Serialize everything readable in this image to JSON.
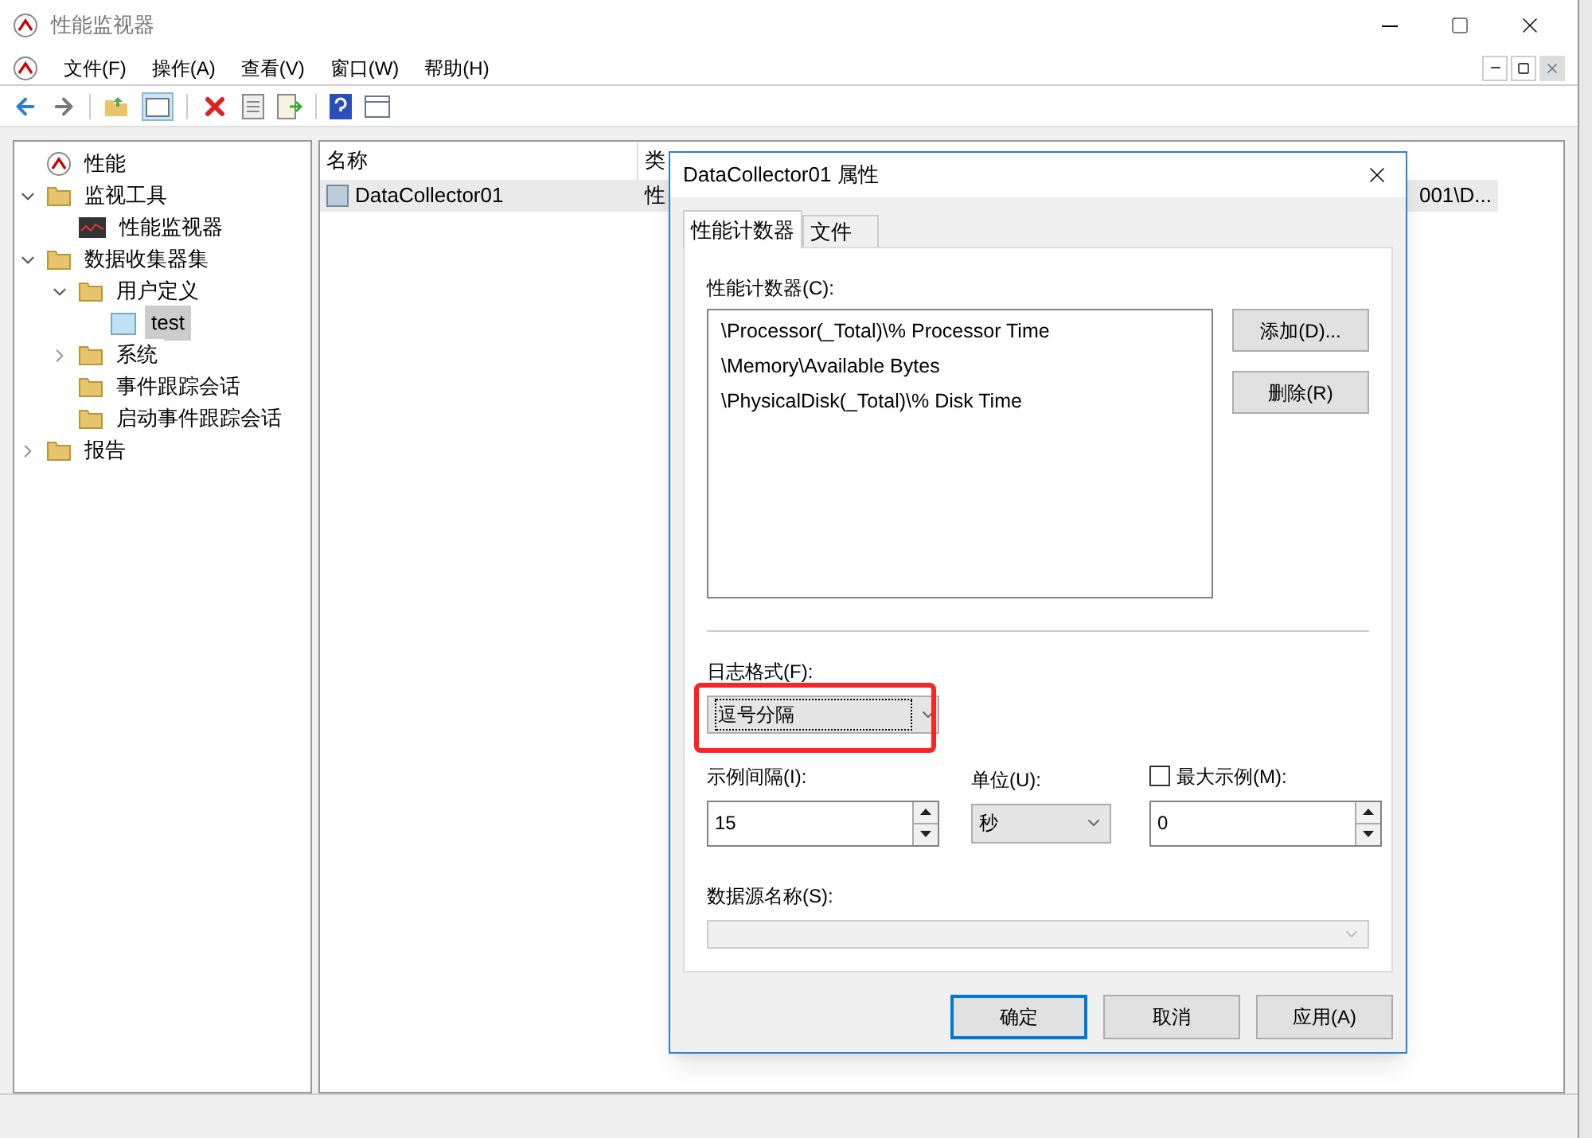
{
  "window": {
    "title": "性能监视器"
  },
  "menu": [
    "文件(F)",
    "操作(A)",
    "查看(V)",
    "窗口(W)",
    "帮助(H)"
  ],
  "tree": [
    {
      "label": "性能",
      "kind": "root",
      "selected": false
    },
    {
      "label": "监视工具",
      "kind": "folder",
      "expanded": true,
      "selected": false,
      "children": [
        {
          "label": "性能监视器",
          "kind": "monitor",
          "selected": false
        }
      ]
    },
    {
      "label": "数据收集器集",
      "kind": "folder",
      "expanded": true,
      "selected": false,
      "children": [
        {
          "label": "用户定义",
          "kind": "folder",
          "expanded": true,
          "selected": false,
          "children": [
            {
              "label": "test",
              "kind": "set",
              "selected": true
            }
          ]
        },
        {
          "label": "系统",
          "kind": "folder",
          "expanded": false,
          "selected": false
        },
        {
          "label": "事件跟踪会话",
          "kind": "folder",
          "selected": false
        },
        {
          "label": "启动事件跟踪会话",
          "kind": "folder",
          "selected": false
        }
      ]
    },
    {
      "label": "报告",
      "kind": "folder",
      "expanded": false,
      "selected": false
    }
  ],
  "table": {
    "columns": [
      "名称",
      "类"
    ],
    "rows": [
      {
        "cells": [
          "DataCollector01",
          "性",
          "001\\D..."
        ],
        "selected": true
      }
    ]
  },
  "dialog": {
    "title": "DataCollector01 属性",
    "tabs": [
      {
        "label": "性能计数器",
        "selected": true
      },
      {
        "label": "文件",
        "selected": false
      }
    ],
    "counters_label": "性能计数器(C):",
    "counters": [
      "\\Processor(_Total)\\% Processor Time",
      "\\Memory\\Available Bytes",
      "\\PhysicalDisk(_Total)\\% Disk Time"
    ],
    "add_button": "添加(D)...",
    "remove_button": "删除(R)",
    "log_format": {
      "label": "日志格式(F):",
      "value": "逗号分隔"
    },
    "interval": {
      "label": "示例间隔(I):",
      "value": "15"
    },
    "unit": {
      "label": "单位(U):",
      "value": "秒"
    },
    "max_samples": {
      "label": "最大示例(M):",
      "checked": false,
      "value": "0"
    },
    "data_source": {
      "label": "数据源名称(S):",
      "disabled": true
    },
    "buttons": [
      {
        "label": "确定",
        "default": true
      },
      {
        "label": "取消",
        "default": false
      },
      {
        "label": "应用(A)",
        "default": false
      }
    ]
  }
}
